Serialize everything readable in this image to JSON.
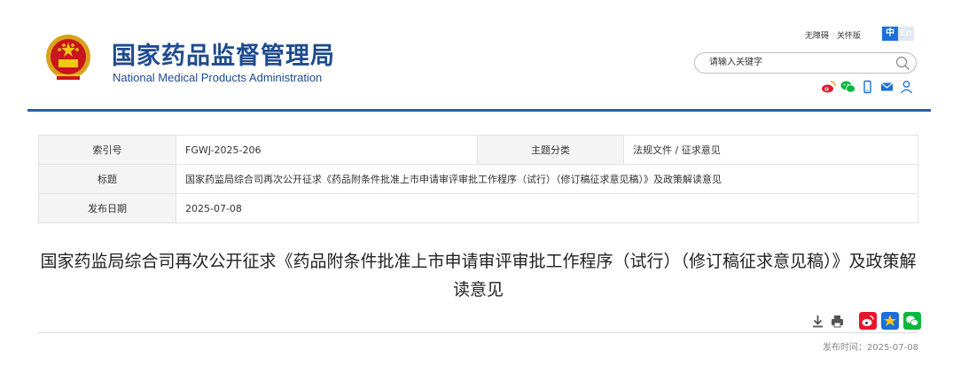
{
  "header": {
    "site_name_cn": "国家药品监督管理局",
    "site_name_en": "National Medical Products Administration",
    "links": [
      "无障碍",
      "关怀版"
    ],
    "lang_active": "中",
    "lang_other": "En",
    "search_placeholder": "请输入关键字",
    "social_icons": [
      "weibo-icon",
      "wechat-icon",
      "mobile-icon",
      "mail-icon",
      "user-icon"
    ],
    "colors": {
      "brand": "#1f4b8f",
      "accent": "#2a5ea6",
      "lang_active": "#1a6fd8"
    }
  },
  "meta": {
    "index_label": "索引号",
    "index_value": "FGWJ-2025-206",
    "category_label": "主题分类",
    "category_value": "法规文件 / 征求意见",
    "title_label": "标题",
    "title_value": "国家药监局综合司再次公开征求《药品附条件批准上市申请审评审批工作程序（试行）（修订稿征求意见稿）》及政策解读意见",
    "date_label": "发布日期",
    "date_value": "2025-07-08"
  },
  "article": {
    "title": "国家药监局综合司再次公开征求《药品附条件批准上市申请审评审批工作程序（试行）（修订稿征求意见稿）》及政策解读意见",
    "tools": [
      "download-icon",
      "print-icon",
      "weibo-share-icon",
      "qzone-share-icon",
      "wechat-share-icon"
    ],
    "publish_time": "发布时间：2025-07-08"
  }
}
